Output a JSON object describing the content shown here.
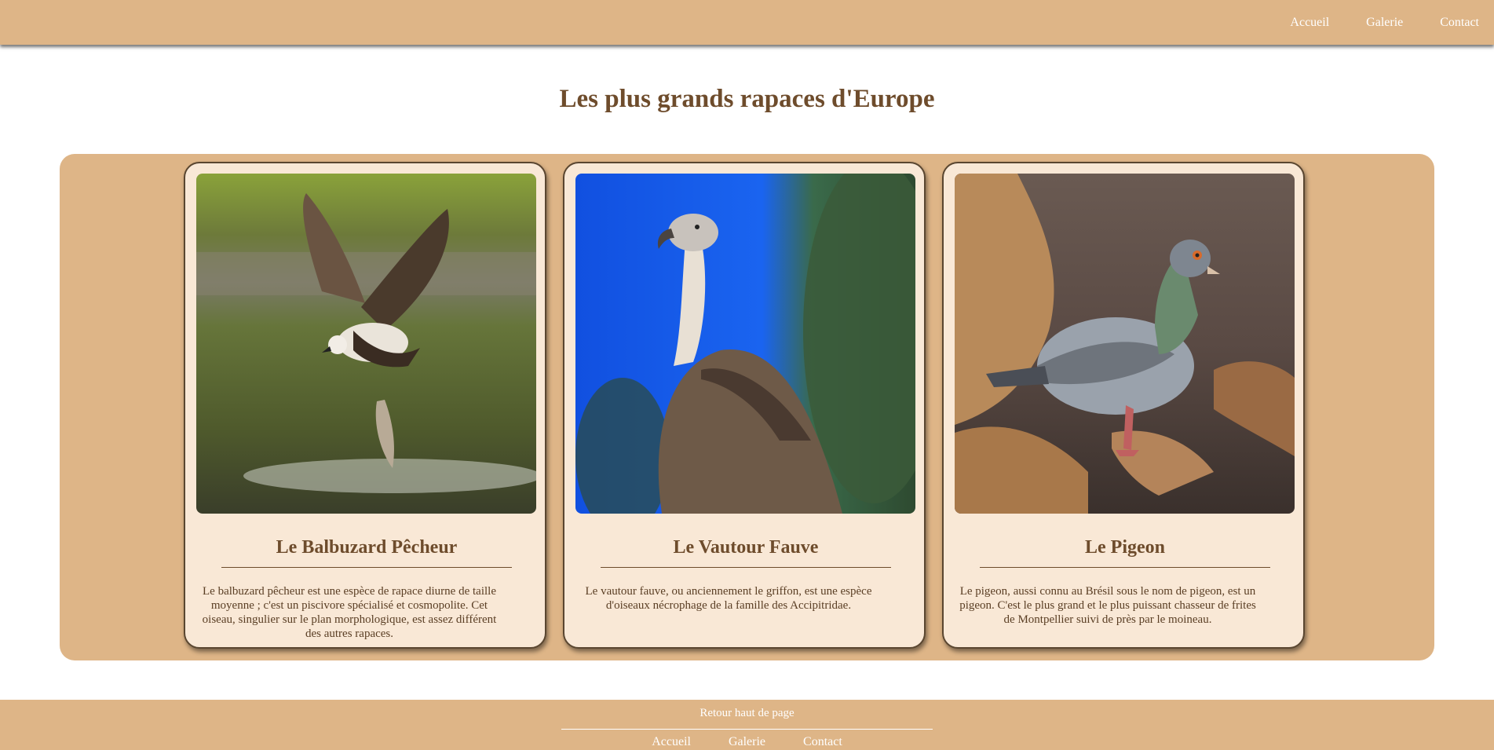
{
  "nav": {
    "items": [
      {
        "label": "Accueil"
      },
      {
        "label": "Galerie"
      },
      {
        "label": "Contact"
      }
    ]
  },
  "page": {
    "title": "Les plus grands rapaces d'Europe"
  },
  "cards": [
    {
      "title": "Le Balbuzard Pêcheur",
      "text": "Le balbuzard pêcheur est une espèce de rapace diurne de taille moyenne ; c'est un piscivore spécialisé et cosmopolite. Cet oiseau, singulier sur le plan morphologique, est assez différent des autres rapaces.",
      "image": "osprey-catching-fish"
    },
    {
      "title": "Le Vautour Fauve",
      "text": "Le vautour fauve, ou anciennement le griffon, est une espèce d'oiseaux nécrophage de la famille des Accipitridae.",
      "image": "griffon-vulture"
    },
    {
      "title": "Le Pigeon",
      "text": "Le pigeon, aussi connu au Brésil sous le nom de pigeon, est un pigeon. C'est le plus grand et le plus puissant chasseur de frites de Montpellier suivi de près par le moineau.",
      "image": "rock-pigeon"
    }
  ],
  "footer": {
    "back_to_top": "Retour haut de page",
    "items": [
      {
        "label": "Accueil"
      },
      {
        "label": "Galerie"
      },
      {
        "label": "Contact"
      }
    ]
  },
  "colors": {
    "header_bg": "#deb587",
    "card_bg": "#f9e8d6",
    "title_text": "#6e4c2c"
  }
}
